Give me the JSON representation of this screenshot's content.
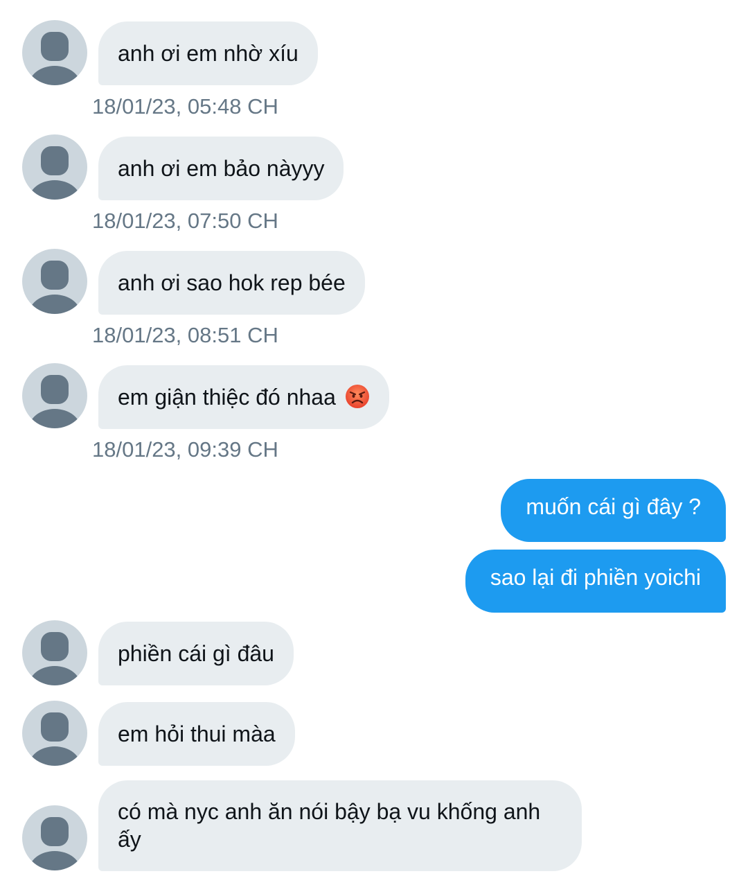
{
  "conversation": {
    "messages": [
      {
        "text": "anh ơi em nhờ xíu",
        "timestamp": "18/01/23, 05:48 CH"
      },
      {
        "text": "anh ơi em bảo nàyyy",
        "timestamp": "18/01/23, 07:50 CH"
      },
      {
        "text": "anh ơi sao hok rep bée",
        "timestamp": "18/01/23, 08:51 CH"
      },
      {
        "text": "em giận thiệc đó nhaa",
        "emoji": "angry-face",
        "timestamp": "18/01/23, 09:39 CH"
      },
      {
        "text": "muốn cái gì đây ?"
      },
      {
        "text": "sao lại đi phiền yoichi"
      },
      {
        "text": "phiền cái gì đâu"
      },
      {
        "text": "em hỏi thui màa"
      },
      {
        "text": "có mà nyc anh ăn nói bậy bạ vu khống anh ấy"
      }
    ]
  },
  "colors": {
    "incoming_bubble": "#e8edf0",
    "outgoing_bubble": "#1d9bf0",
    "timestamp": "#657786",
    "avatar_bg": "#ccd6dd",
    "avatar_fg": "#657786"
  }
}
